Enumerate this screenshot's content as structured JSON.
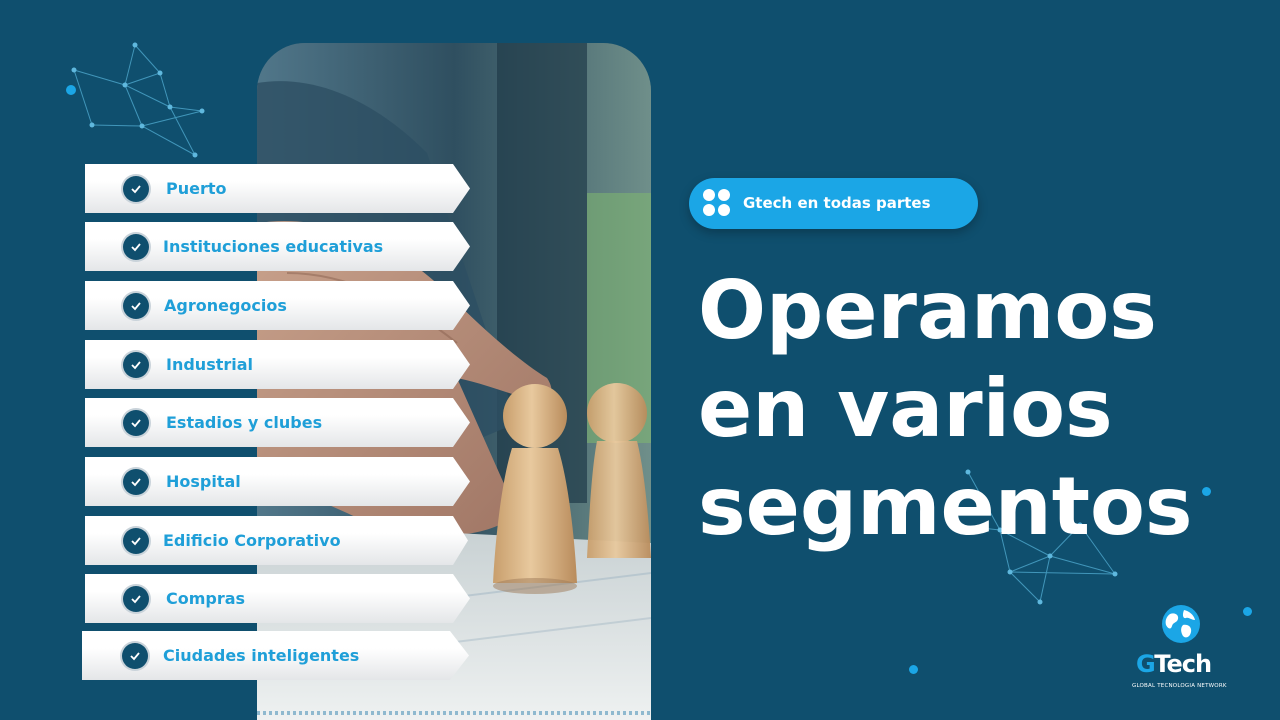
{
  "segments": [
    {
      "label": "Puerto"
    },
    {
      "label": "Instituciones educativas"
    },
    {
      "label": "Agronegocios"
    },
    {
      "label": "Industrial"
    },
    {
      "label": "Estadios y clubes"
    },
    {
      "label": "Hospital"
    },
    {
      "label": "Edificio Corporativo"
    },
    {
      "label": "Compras"
    },
    {
      "label": "Ciudades inteligentes"
    }
  ],
  "pill": {
    "label": "Gtech en todas partes",
    "icon": "four-dots-grid-icon"
  },
  "headline": {
    "line1": "Operamos",
    "line2": "en varios",
    "line3": "segmentos"
  },
  "logo": {
    "brand_g": "G",
    "brand_rest": "Tech",
    "tagline": "GLOBAL TECNOLOGIA NETWORK",
    "icon": "globe-icon"
  },
  "colors": {
    "background": "#0f4f6e",
    "accent": "#1ba6e6",
    "label": "#1f9fd8",
    "white": "#ffffff"
  }
}
